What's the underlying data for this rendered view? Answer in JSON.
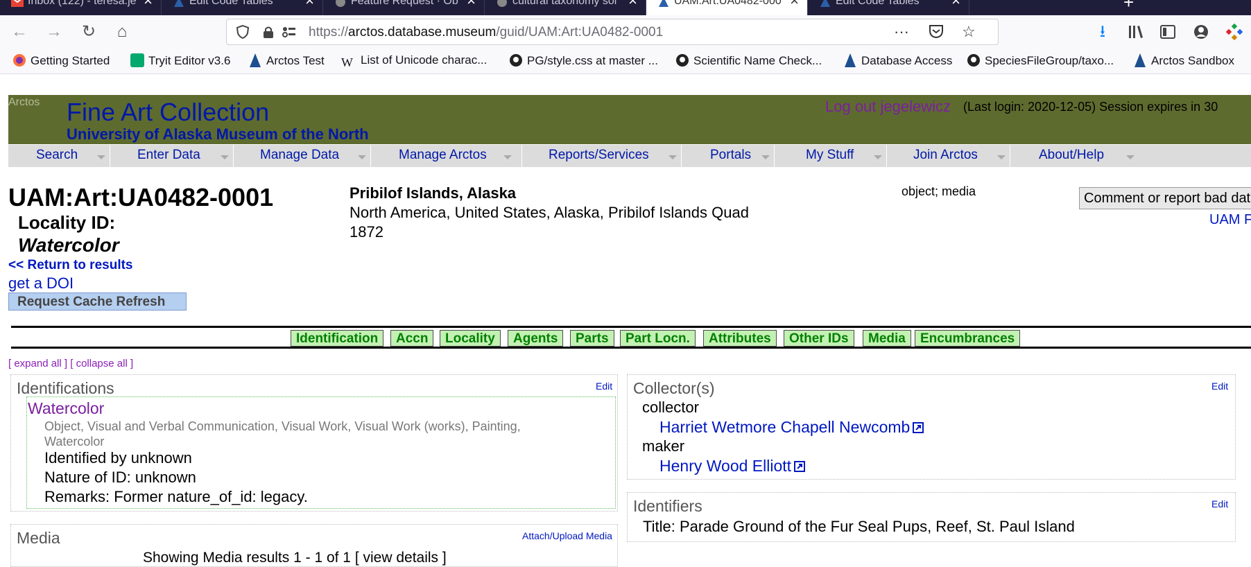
{
  "browser": {
    "tabs": [
      {
        "label": "Inbox (122) - teresa.je"
      },
      {
        "label": "Edit Code Tables"
      },
      {
        "label": "Feature Request · Ob"
      },
      {
        "label": "cultural taxonomy sol"
      },
      {
        "label": "UAM:Art:UA0482-000"
      },
      {
        "label": "Edit Code Tables"
      }
    ],
    "url_prefix": "https://",
    "url_host": "arctos.database.museum",
    "url_path": "/guid/UAM:Art:UA0482-0001",
    "bookmarks": [
      {
        "label": "Getting Started"
      },
      {
        "label": "Tryit Editor v3.6"
      },
      {
        "label": "Arctos Test"
      },
      {
        "label": "List of Unicode charac..."
      },
      {
        "label": "PG/style.css at master ..."
      },
      {
        "label": "Scientific Name Check..."
      },
      {
        "label": "Database Access"
      },
      {
        "label": "SpeciesFileGroup/taxo..."
      },
      {
        "label": "Arctos Sandbox"
      }
    ]
  },
  "site": {
    "small": "Arctos",
    "title": "Fine Art Collection",
    "subtitle": "University of Alaska Museum of the North",
    "logout": "Log out jegelewicz",
    "login_info": "(Last login: 2020-12-05)  Session expires in 30",
    "menu": [
      "Search",
      "Enter Data",
      "Manage Data",
      "Manage Arctos",
      "Reports/Services",
      "Portals",
      "My Stuff",
      "Join Arctos",
      "About/Help"
    ]
  },
  "record": {
    "guid": "UAM:Art:UA0482-0001",
    "locality_label": "Locality ID:",
    "scientific_name": "Watercolor",
    "return_link": "<< Return to results",
    "doi_link": "get a DOI",
    "cache_button": "Request Cache Refresh",
    "place": "Pribilof Islands, Alaska",
    "geography": "North America, United States, Alaska, Pribilof Islands Quad",
    "year": "1872",
    "type": "object; media",
    "comment_button": "Comment or report bad data",
    "collection_link": "UAM Fi"
  },
  "section_nav": [
    "Identification",
    "Accn",
    "Locality",
    "Agents",
    "Parts",
    "Part Locn.",
    "Attributes",
    "Other IDs",
    "Media",
    "Encumbrances"
  ],
  "expand_all": "[ expand all ]",
  "collapse_all": "[ collapse all ]",
  "identifications": {
    "title": "Identifications",
    "edit": "Edit",
    "name": "Watercolor",
    "taxonomy": "Object, Visual and Verbal Communication, Visual Work, Visual Work (works), Painting, Watercolor",
    "identified_by": "Identified by unknown",
    "nature": "Nature of ID: unknown",
    "remarks": "Remarks: Former nature_of_id: legacy."
  },
  "collectors": {
    "title": "Collector(s)",
    "edit": "Edit",
    "roles": [
      {
        "role": "collector",
        "name": "Harriet Wetmore Chapell Newcomb"
      },
      {
        "role": "maker",
        "name": "Henry Wood Elliott"
      }
    ]
  },
  "identifiers": {
    "title": "Identifiers",
    "edit": "Edit",
    "line": "Title: Parade Ground of the Fur Seal Pups, Reef, St. Paul Island"
  },
  "media": {
    "title": "Media",
    "attach": "Attach/Upload Media",
    "showing": "Showing Media results 1 - 1 of 1 [ view details ]"
  }
}
